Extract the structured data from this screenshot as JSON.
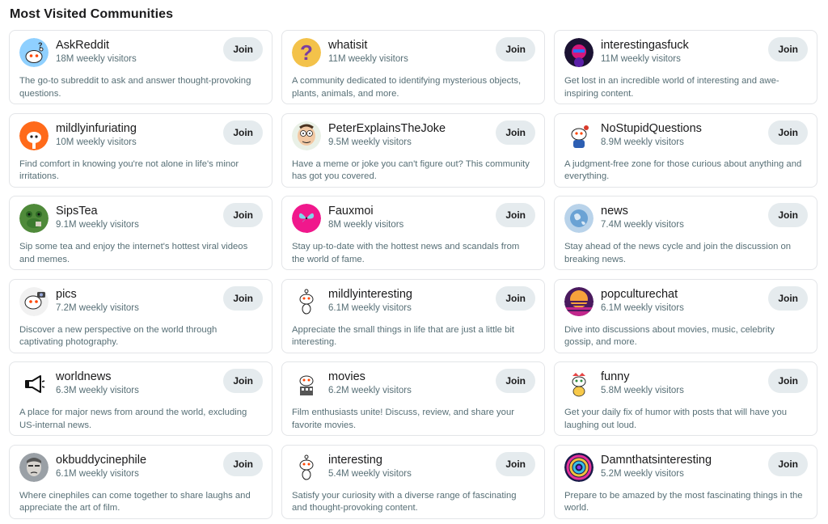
{
  "section_title": "Most Visited Communities",
  "join_label": "Join",
  "communities": [
    {
      "name": "AskReddit",
      "visitors": "18M weekly visitors",
      "description": "The go-to subreddit to ask and answer thought-provoking questions.",
      "icon": "askreddit-icon"
    },
    {
      "name": "whatisit",
      "visitors": "11M weekly visitors",
      "description": "A community dedicated to identifying mysterious objects, plants, animals, and more.",
      "icon": "question-mark-icon"
    },
    {
      "name": "interestingasfuck",
      "visitors": "11M weekly visitors",
      "description": "Get lost in an incredible world of interesting and awe-inspiring content.",
      "icon": "neon-face-icon"
    },
    {
      "name": "mildlyinfuriating",
      "visitors": "10M weekly visitors",
      "description": "Find comfort in knowing you're not alone in life's minor irritations.",
      "icon": "angry-snoo-icon"
    },
    {
      "name": "PeterExplainsTheJoke",
      "visitors": "9.5M weekly visitors",
      "description": "Have a meme or joke you can't figure out? This community has got you covered.",
      "icon": "cartoon-face-icon"
    },
    {
      "name": "NoStupidQuestions",
      "visitors": "8.9M weekly visitors",
      "description": "A judgment-free zone for those curious about anything and everything.",
      "icon": "curious-snoo-icon"
    },
    {
      "name": "SipsTea",
      "visitors": "9.1M weekly visitors",
      "description": "Sip some tea and enjoy the internet's hottest viral videos and memes.",
      "icon": "frog-icon"
    },
    {
      "name": "Fauxmoi",
      "visitors": "8M weekly visitors",
      "description": "Stay up-to-date with the hottest news and scandals from the world of fame.",
      "icon": "butterfly-icon"
    },
    {
      "name": "news",
      "visitors": "7.4M weekly visitors",
      "description": "Stay ahead of the news cycle and join the discussion on breaking news.",
      "icon": "globe-icon"
    },
    {
      "name": "pics",
      "visitors": "7.2M weekly visitors",
      "description": "Discover a new perspective on the world through captivating photography.",
      "icon": "camera-snoo-icon"
    },
    {
      "name": "mildlyinteresting",
      "visitors": "6.1M weekly visitors",
      "description": "Appreciate the small things in life that are just a little bit interesting.",
      "icon": "snoo-icon"
    },
    {
      "name": "popculturechat",
      "visitors": "6.1M weekly visitors",
      "description": "Dive into discussions about movies, music, celebrity gossip, and more.",
      "icon": "sunset-icon"
    },
    {
      "name": "worldnews",
      "visitors": "6.3M weekly visitors",
      "description": "A place for major news from around the world, excluding US-internal news.",
      "icon": "megaphone-icon"
    },
    {
      "name": "movies",
      "visitors": "6.2M weekly visitors",
      "description": "Film enthusiasts unite! Discuss, review, and share your favorite movies.",
      "icon": "movie-snoo-icon"
    },
    {
      "name": "funny",
      "visitors": "5.8M weekly visitors",
      "description": "Get your daily fix of humor with posts that will have you laughing out loud.",
      "icon": "funny-snoo-icon"
    },
    {
      "name": "okbuddycinephile",
      "visitors": "6.1M weekly visitors",
      "description": "Where cinephiles can come together to share laughs and appreciate the art of film.",
      "icon": "portrait-icon"
    },
    {
      "name": "interesting",
      "visitors": "5.4M weekly visitors",
      "description": "Satisfy your curiosity with a diverse range of fascinating and thought-provoking content.",
      "icon": "snoo-icon"
    },
    {
      "name": "Damnthatsinteresting",
      "visitors": "5.2M weekly visitors",
      "description": "Prepare to be amazed by the most fascinating things in the world.",
      "icon": "spiral-icon"
    }
  ]
}
